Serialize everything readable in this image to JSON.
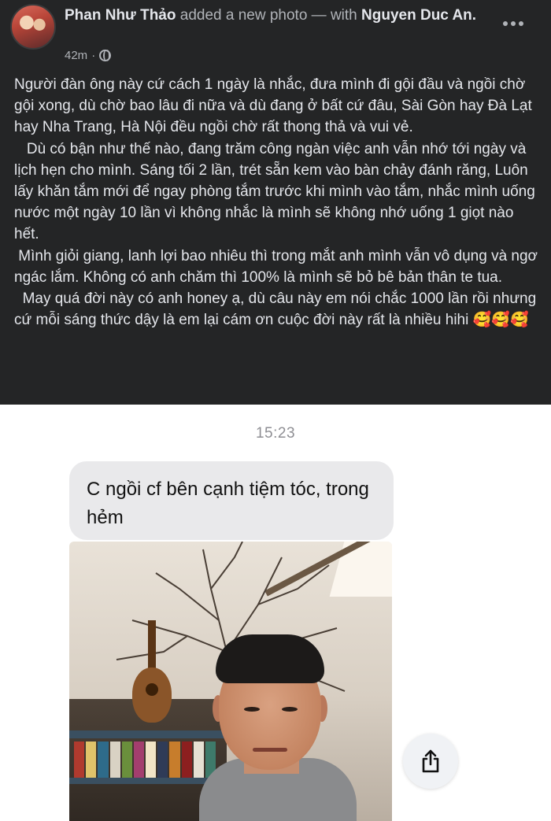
{
  "post": {
    "author": "Phan Như Thảo",
    "action": " added a new photo — with ",
    "tagged": "Nguyen Duc An",
    "tagged_suffix": ".",
    "time": "42m",
    "privacy_icon": "globe-icon",
    "more_icon": "more-horizontal-icon",
    "paragraphs": [
      "Người đàn ông này cứ cách 1 ngày là nhắc, đưa mình đi gội đầu và ngồi chờ gội xong, dù chờ bao lâu đi nữa và dù đang ở bất cứ đâu, Sài Gòn hay Đà Lạt hay Nha Trang, Hà Nội đều ngồi chờ rất thong thả và vui vẻ.",
      "   Dù có bận như thế nào, đang trăm công ngàn việc anh vẫn nhớ tới ngày và lịch hẹn cho mình. Sáng tối 2 lần, trét sẵn kem vào bàn chảy đánh răng, Luôn lấy khăn tắm mới để ngay phòng tắm trước khi mình vào tắm, nhắc mình uống nước một ngày 10 lần vì không nhắc là mình sẽ không nhớ uống 1 giọt nào hết.",
      " Mình giỏi giang, lanh lợi bao nhiêu thì trong mắt anh mình vẫn vô dụng và ngơ ngác lắm. Không có anh chăm thì 100% là mình sẽ bỏ bê bản thân te tua.",
      "  May quá đời này có anh honey ạ, dù câu này em nói chắc 1000 lần rồi nhưng cứ mỗi sáng thức dậy là em lại cám ơn cuộc đời này rất là nhiều hihi 🥰🥰🥰"
    ]
  },
  "photo": {
    "message_time": "15:23",
    "message_text": "C ngồi cf bên cạnh tiệm tóc, trong hẻm",
    "share_icon": "share-icon"
  },
  "colors": {
    "background": "#242526",
    "text_primary": "#e4e6eb",
    "text_secondary": "#b0b3b8",
    "bubble": "#e9e9eb"
  }
}
